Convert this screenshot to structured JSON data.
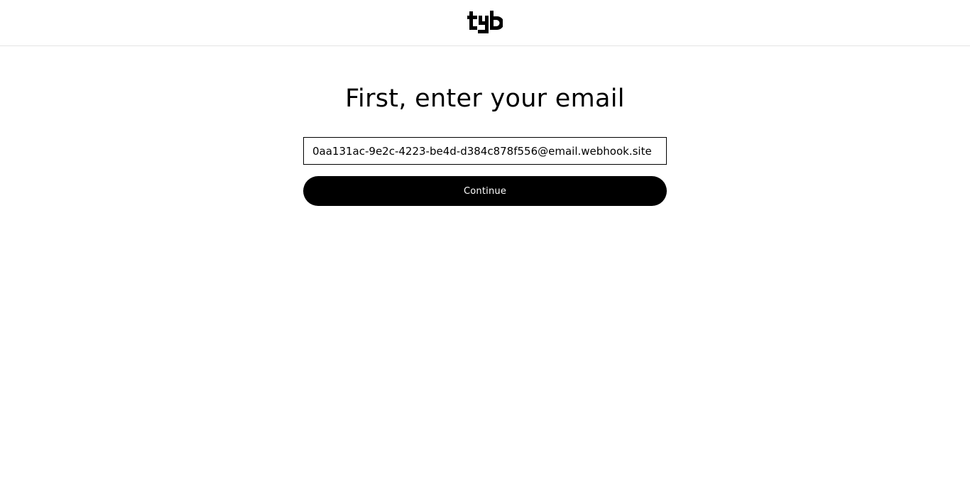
{
  "header": {
    "logo_text": "tyb",
    "logo_icon": "tyb-logo"
  },
  "main": {
    "heading": "First, enter your email",
    "email_value": "0aa131ac-9e2c-4223-be4d-d384c878f556@email.webhook.site",
    "continue_label": "Continue"
  },
  "colors": {
    "background": "#ffffff",
    "text": "#000000",
    "button_bg": "#000000",
    "button_text": "#ffffff",
    "divider": "#e4e4e4"
  }
}
